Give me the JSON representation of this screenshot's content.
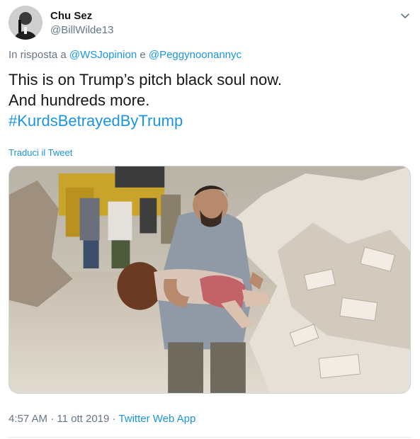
{
  "user": {
    "display_name": "Chu Sez",
    "handle": "@BillWilde13"
  },
  "reply": {
    "prefix": "In risposta a",
    "mention_1": "@WSJopinion",
    "conjunction": "e",
    "mention_2": "@Peggynoonannyc"
  },
  "tweet": {
    "line_1": "This is on Trump’s pitch black soul now.",
    "line_2": "And hundreds more.",
    "hashtag": "#KurdsBetrayedByTrump",
    "translate_label": "Traduci il Tweet"
  },
  "meta": {
    "time": "4:57 AM",
    "separator": "·",
    "date": "11 ott 2019",
    "source": "Twitter Web App"
  },
  "icons": {
    "menu": "chevron-down-icon"
  },
  "colors": {
    "link": "#1b95e0",
    "secondary_text": "#657786",
    "primary_text": "#14171a"
  }
}
